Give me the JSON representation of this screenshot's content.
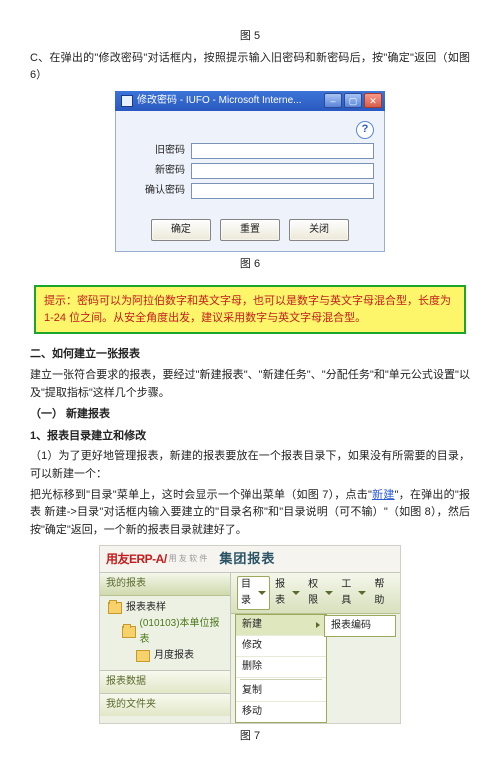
{
  "fig5_caption": "图 5",
  "paraC": "C、在弹出的\"修改密码\"对话框内，按照提示输入旧密码和新密码后，按\"确定\"返回（如图 6）",
  "dialog": {
    "title": "修改密码 - IUFO - Microsoft Interne...",
    "min_glyph": "–",
    "max_glyph": "▢",
    "close_glyph": "✕",
    "help_glyph": "?",
    "label_old": "旧密码",
    "label_new": "新密码",
    "label_confirm": "确认密码",
    "btn_ok": "确定",
    "btn_reset": "重置",
    "btn_close": "关闭"
  },
  "fig6_caption": "图 6",
  "tip": "提示：密码可以为阿拉伯数字和英文字母，也可以是数字与英文字母混合型，长度为 1-24 位之间。从安全角度出发，建议采用数字与英文字母混合型。",
  "sec2_heading": "二、如何建立一张报表",
  "sec2_p1": "建立一张符合要求的报表，要经过\"新建报表\"、\"新建任务\"、\"分配任务\"和\"单元公式设置\"以及\"提取指标\"这样几个步骤。",
  "sec2_sub1_heading": "（一） 新建报表",
  "sec2_item1_heading": "1、报表目录建立和修改",
  "sec2_item1_p1": "（1）为了更好地管理报表，新建的报表要放在一个报表目录下，如果没有所需要的目录，可以新建一个：",
  "sec2_item1_p2a": "把光标移到\"目录\"菜单上，这时会显示一个弹出菜单（如图 7），点击\"",
  "sec2_item1_p2_link": "新建",
  "sec2_item1_p2b": "\"，在弹出的\"报表 新建->目录\"对话框内输入要建立的\"目录名称\"和\"目录说明（可不输）\"（如图 8），然后按\"确定\"返回，一个新的报表目录就建好了。",
  "fig7": {
    "brand": "用友ERP-A/",
    "brand_sub": "用 友 软 件",
    "title": "集团报表",
    "pane_myreport": "我的报表",
    "tree_root": "报表表样",
    "tree_child1": "(010103)本单位报表",
    "tree_child2": "月度报表",
    "pane_data": "报表数据",
    "pane_myfolder": "我的文件夹",
    "menu_dir": "目录",
    "menu_rpt": "报表",
    "menu_perm": "权限",
    "menu_tool": "工具",
    "menu_help": "帮助",
    "dd_new": "新建",
    "dd_new_sub": "报表编码",
    "dd_modify": "修改",
    "dd_delete": "删除",
    "dd_copy": "复制",
    "dd_move": "移动"
  },
  "fig7_caption": "图 7"
}
